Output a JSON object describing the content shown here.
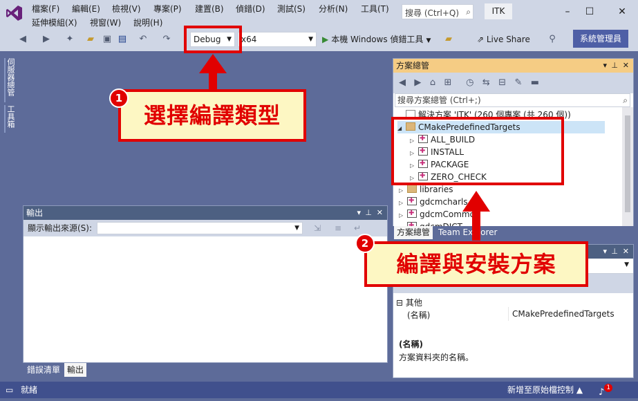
{
  "title_bar": {
    "menu_row1": [
      "檔案(F)",
      "編輯(E)",
      "檢視(V)",
      "專案(P)",
      "建置(B)",
      "偵錯(D)",
      "測試(S)",
      "分析(N)",
      "工具(T)"
    ],
    "menu_row2": [
      "延伸模組(X)",
      "視窗(W)",
      "說明(H)"
    ],
    "search_placeholder": "搜尋 (Ctrl+Q)",
    "solution_name": "ITK",
    "window_controls": [
      "–",
      "☐",
      "✕"
    ]
  },
  "toolbar": {
    "configuration": "Debug",
    "platform": "x64",
    "run_label": "本機 Windows 偵錯工具",
    "live_share": "Live Share",
    "admin_label": "系統管理員"
  },
  "left_tabs": [
    "伺服器總管",
    "工具箱"
  ],
  "output": {
    "title": "輸出",
    "source_label": "顯示輸出來源(S):",
    "tabs": [
      "錯誤清單",
      "輸出"
    ]
  },
  "solution_explorer": {
    "title": "方案總管",
    "search_placeholder": "搜尋方案總管 (Ctrl+;)",
    "tree": [
      {
        "label": "解決方案 'ITK' (260 個專案 (共 260 個))",
        "icon": "solution",
        "toggle": ""
      },
      {
        "label": "CMakePredefinedTargets",
        "icon": "folder",
        "toggle": "◢",
        "selected": true
      },
      {
        "label": "ALL_BUILD",
        "icon": "project",
        "toggle": "▷"
      },
      {
        "label": "INSTALL",
        "icon": "project",
        "toggle": "▷"
      },
      {
        "label": "PACKAGE",
        "icon": "project",
        "toggle": "▷"
      },
      {
        "label": "ZERO_CHECK",
        "icon": "project",
        "toggle": "▷"
      },
      {
        "label": "libraries",
        "icon": "folder",
        "toggle": "▷"
      },
      {
        "label": "gdcmcharls",
        "icon": "project",
        "toggle": "▷"
      },
      {
        "label": "gdcmCommon",
        "icon": "project",
        "toggle": "▷"
      },
      {
        "label": "gdcmDICT",
        "icon": "project",
        "toggle": "▷"
      }
    ],
    "tabs": [
      "方案總管",
      "Team Explorer"
    ]
  },
  "properties": {
    "category": "其他",
    "property_name": "(名稱)",
    "property_value": "CMakePredefinedTargets",
    "desc_title": "(名稱)",
    "desc_text": "方案資料夾的名稱。"
  },
  "status_bar": {
    "ready": "就緒",
    "source_control": "新增至原始檔控制 ▲",
    "notification_count": "1"
  },
  "annotations": {
    "callout1": {
      "number": "1",
      "text": "選擇編譯類型"
    },
    "callout2": {
      "number": "2",
      "text": "編譯與安裝方案"
    }
  },
  "colors": {
    "annotation_red": "#e10000",
    "callout_bg": "#fdf7c3",
    "workspace_bg": "#5d6b99",
    "active_header": "#f5cc84"
  }
}
